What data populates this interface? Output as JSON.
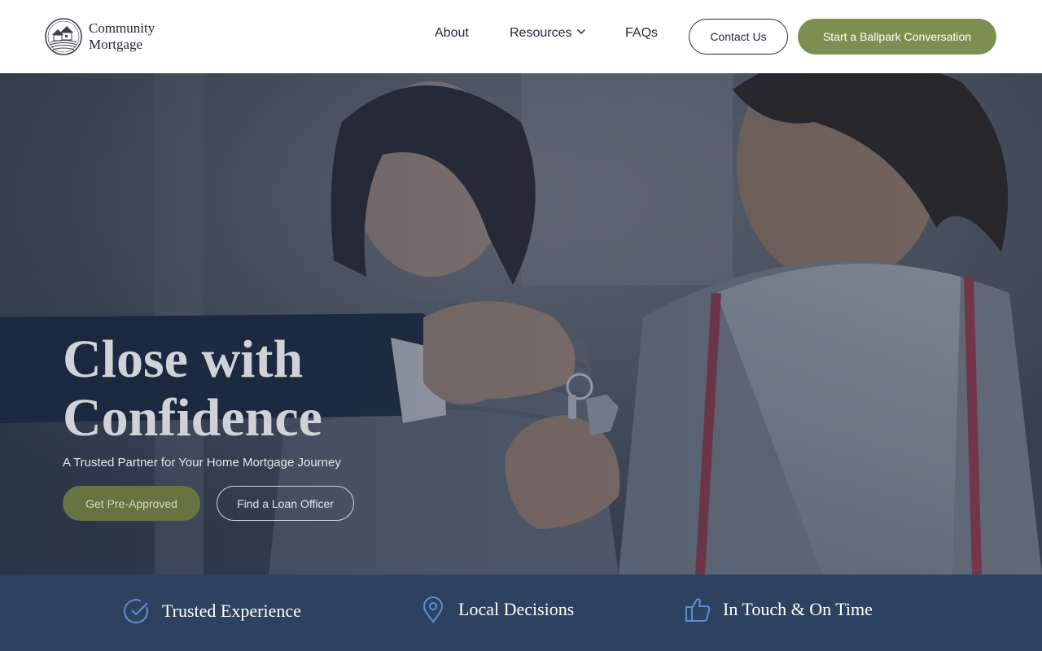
{
  "brand": {
    "name_line1": "Community",
    "name_line2": "Mortgage"
  },
  "nav": {
    "about": "About",
    "resources": "Resources",
    "faqs": "FAQs",
    "contact_button": "Contact Us",
    "cta_button": "Start a Ballpark Conversation"
  },
  "hero": {
    "title_line1": "Close with",
    "title_line2": "Confidence",
    "subtitle": "A Trusted Partner for Your Home Mortgage Journey",
    "primary_button": "Get Pre-Approved",
    "secondary_button": "Find a Loan Officer",
    "image_subject": "key-handover-photo"
  },
  "features": [
    {
      "label": "Trusted Experience",
      "icon": "check-circle-icon"
    },
    {
      "label": "Local Decisions",
      "icon": "location-pin-icon"
    },
    {
      "label": "In Touch & On Time",
      "icon": "thumbs-up-icon"
    }
  ],
  "colors": {
    "accent_green": "#7d9052",
    "features_band": "#2d4260",
    "icon_blue": "#5b8fd6"
  }
}
